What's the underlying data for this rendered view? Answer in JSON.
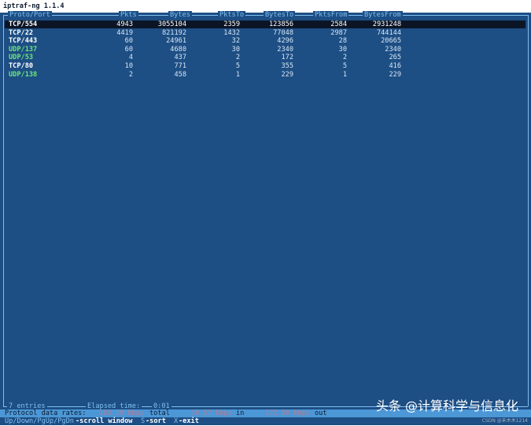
{
  "window": {
    "title": "iptraf-ng 1.1.4"
  },
  "columns": [
    "Proto/Port",
    "Pkts",
    "Bytes",
    "PktsTo",
    "BytesTo",
    "PktsFrom",
    "BytesFrom"
  ],
  "rows": [
    {
      "proto": "TCP/554",
      "kind": "tcp",
      "pkts": "4943",
      "bytes": "3055104",
      "pkts_to": "2359",
      "bytes_to": "123856",
      "pkts_from": "2584",
      "bytes_from": "2931248",
      "selected": true
    },
    {
      "proto": "TCP/22",
      "kind": "tcp",
      "pkts": "4419",
      "bytes": "821192",
      "pkts_to": "1432",
      "bytes_to": "77048",
      "pkts_from": "2987",
      "bytes_from": "744144"
    },
    {
      "proto": "TCP/443",
      "kind": "tcp",
      "pkts": "60",
      "bytes": "24961",
      "pkts_to": "32",
      "bytes_to": "4296",
      "pkts_from": "28",
      "bytes_from": "20665"
    },
    {
      "proto": "UDP/137",
      "kind": "udp",
      "pkts": "60",
      "bytes": "4680",
      "pkts_to": "30",
      "bytes_to": "2340",
      "pkts_from": "30",
      "bytes_from": "2340"
    },
    {
      "proto": "UDP/53",
      "kind": "udp",
      "pkts": "4",
      "bytes": "437",
      "pkts_to": "2",
      "bytes_to": "172",
      "pkts_from": "2",
      "bytes_from": "265"
    },
    {
      "proto": "TCP/80",
      "kind": "tcp",
      "pkts": "10",
      "bytes": "771",
      "pkts_to": "5",
      "bytes_to": "355",
      "pkts_from": "5",
      "bytes_from": "416"
    },
    {
      "proto": "UDP/138",
      "kind": "udp",
      "pkts": "2",
      "bytes": "458",
      "pkts_to": "1",
      "bytes_to": "229",
      "pkts_from": "1",
      "bytes_from": "229"
    }
  ],
  "status": {
    "entries": "7 entries",
    "elapsed_label": "Elapsed time:",
    "elapsed_value": "0:01"
  },
  "rates": {
    "label": "Protocol data rates:",
    "total_value": "183.19 kbps",
    "total_label": "total",
    "in_value": "10.57 kbps",
    "in_label": "in",
    "out_value": "172.58 kbps",
    "out_label": "out"
  },
  "keys": {
    "nav": "Up/Down/PgUp/PgDn",
    "nav_desc": "-scroll window",
    "sort_key": "S",
    "sort_desc": "-sort",
    "exit_key": "X",
    "exit_desc": "-exit"
  },
  "watermark": "头条 @计算科学与信息化",
  "csdn_mark": "CSDN @禾木木1214",
  "colors": {
    "background": "#1d4e84",
    "border": "#7fc0f2",
    "tcp": "#ffffff",
    "udp": "#6ee67c",
    "selected_row": "#0c1526"
  }
}
